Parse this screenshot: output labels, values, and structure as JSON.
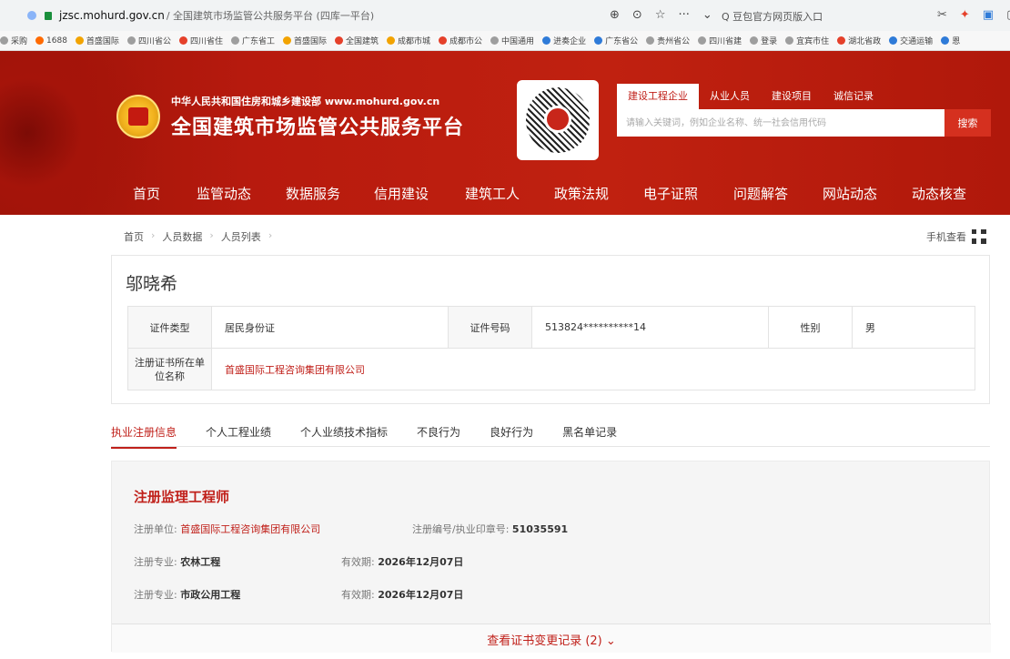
{
  "browser": {
    "domain": "jzsc.mohurd.gov.cn",
    "path": "/ 全国建筑市场监管公共服务平台 (四库一平台)",
    "tools": [
      "⊕",
      "⊙",
      "☆",
      "···",
      "⌄"
    ],
    "search_hint": "Q 豆包官方网页版入口",
    "ext": [
      "✂",
      "✦",
      "▣",
      "▢"
    ]
  },
  "bookmarks": [
    {
      "label": "采购",
      "color": "#9e9e9e"
    },
    {
      "label": "1688",
      "color": "#ff6a00"
    },
    {
      "label": "首盛国际",
      "color": "#f2a300"
    },
    {
      "label": "四川省公",
      "color": "#9e9e9e"
    },
    {
      "label": "四川省住",
      "color": "#e5402a"
    },
    {
      "label": "广东省工",
      "color": "#9e9e9e"
    },
    {
      "label": "首盛国际",
      "color": "#f2a300"
    },
    {
      "label": "全国建筑",
      "color": "#e5402a"
    },
    {
      "label": "成都市城",
      "color": "#f2a300"
    },
    {
      "label": "成都市公",
      "color": "#e5402a"
    },
    {
      "label": "中国通用",
      "color": "#9e9e9e"
    },
    {
      "label": "进奏企业",
      "color": "#2f7bd8"
    },
    {
      "label": "广东省公",
      "color": "#2f7bd8"
    },
    {
      "label": "贵州省公",
      "color": "#9e9e9e"
    },
    {
      "label": "四川省建",
      "color": "#9e9e9e"
    },
    {
      "label": "登录",
      "color": "#9e9e9e"
    },
    {
      "label": "宜宾市住",
      "color": "#9e9e9e"
    },
    {
      "label": "湖北省政",
      "color": "#e5402a"
    },
    {
      "label": "交通运输",
      "color": "#2f7bd8"
    },
    {
      "label": "恩",
      "color": "#2f7bd8"
    }
  ],
  "site": {
    "ministry": "中华人民共和国住房和城乡建设部  www.mohurd.gov.cn",
    "title": "全国建筑市场监管公共服务平台",
    "search_tabs": [
      "建设工程企业",
      "从业人员",
      "建设项目",
      "诚信记录"
    ],
    "search_placeholder": "请输入关键词，例如企业名称、统一社会信用代码",
    "search_button": "搜索",
    "nav": [
      "首页",
      "监管动态",
      "数据服务",
      "信用建设",
      "建筑工人",
      "政策法规",
      "电子证照",
      "问题解答",
      "网站动态",
      "动态核查"
    ]
  },
  "breadcrumb": [
    "首页",
    "人员数据",
    "人员列表"
  ],
  "mobile_view": "手机查看",
  "person": {
    "name": "邬晓希",
    "id_type_label": "证件类型",
    "id_type": "居民身份证",
    "id_no_label": "证件号码",
    "id_no": "513824**********14",
    "gender_label": "性别",
    "gender": "男",
    "company_label": "注册证书所在单位名称",
    "company": "首盛国际工程咨询集团有限公司"
  },
  "tabs": [
    "执业注册信息",
    "个人工程业绩",
    "个人业绩技术指标",
    "不良行为",
    "良好行为",
    "黑名单记录"
  ],
  "registration": {
    "title": "注册监理工程师",
    "unit_label": "注册单位: ",
    "unit": "首盛国际工程咨询集团有限公司",
    "no_label": "注册编号/执业印章号: ",
    "no": "51035591",
    "specialties": [
      {
        "label": "注册专业: ",
        "value": "农林工程",
        "exp_label": "有效期: ",
        "exp": "2026年12月07日"
      },
      {
        "label": "注册专业: ",
        "value": "市政公用工程",
        "exp_label": "有效期: ",
        "exp": "2026年12月07日"
      }
    ],
    "changes_link": "查看证书变更记录 (2)  ⌄"
  }
}
